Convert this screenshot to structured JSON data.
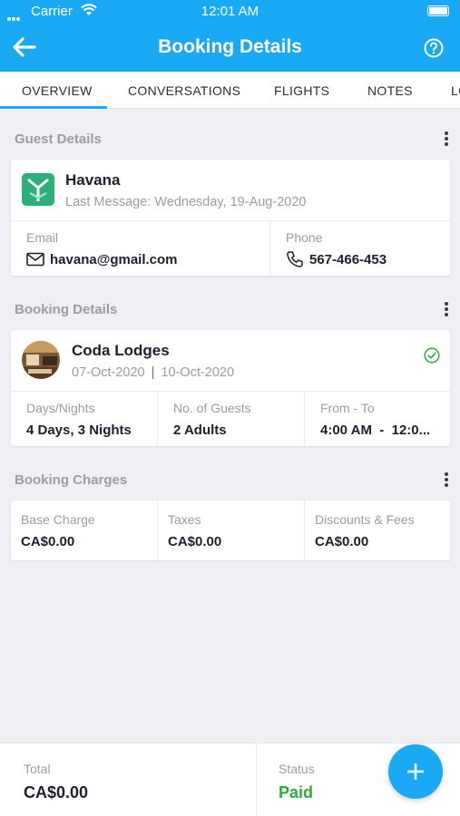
{
  "status_bar": {
    "carrier": "Carrier",
    "time": "12:01 AM"
  },
  "nav": {
    "title": "Booking Details",
    "back_icon": "arrow-left-icon",
    "help_icon": "help-circle-icon"
  },
  "tabs": [
    {
      "label": "OVERVIEW",
      "selected": true
    },
    {
      "label": "CONVERSATIONS"
    },
    {
      "label": "FLIGHTS"
    },
    {
      "label": "NOTES"
    },
    {
      "label": "LO"
    }
  ],
  "guest": {
    "section_title": "Guest Details",
    "name": "Havana",
    "last_message": "Last Message: Wednesday, 19-Aug-2020",
    "email_label": "Email",
    "email": "havana@gmail.com",
    "phone_label": "Phone",
    "phone": "567-466-453"
  },
  "booking": {
    "section_title": "Booking Details",
    "property": "Coda Lodges",
    "check_in": "07-Oct-2020",
    "separator": "|",
    "check_out": "10-Oct-2020",
    "days_label": "Days/Nights",
    "days_value": "4 Days, 3 Nights",
    "guests_label": "No. of Guests",
    "guests_value": "2 Adults",
    "from_to_label": "From - To",
    "from_to_value": "4:00 AM  -  12:0..."
  },
  "charges": {
    "section_title": "Booking Charges",
    "base_label": "Base Charge",
    "base_value": "CA$0.00",
    "taxes_label": "Taxes",
    "taxes_value": "CA$0.00",
    "discounts_label": "Discounts & Fees",
    "discounts_value": "CA$0.00"
  },
  "footer": {
    "total_label": "Total",
    "total_value": "CA$0.00",
    "status_label": "Status",
    "status_value": "Paid",
    "status_color": "#2eaa3f"
  },
  "colors": {
    "accent": "#1aa9f5"
  }
}
